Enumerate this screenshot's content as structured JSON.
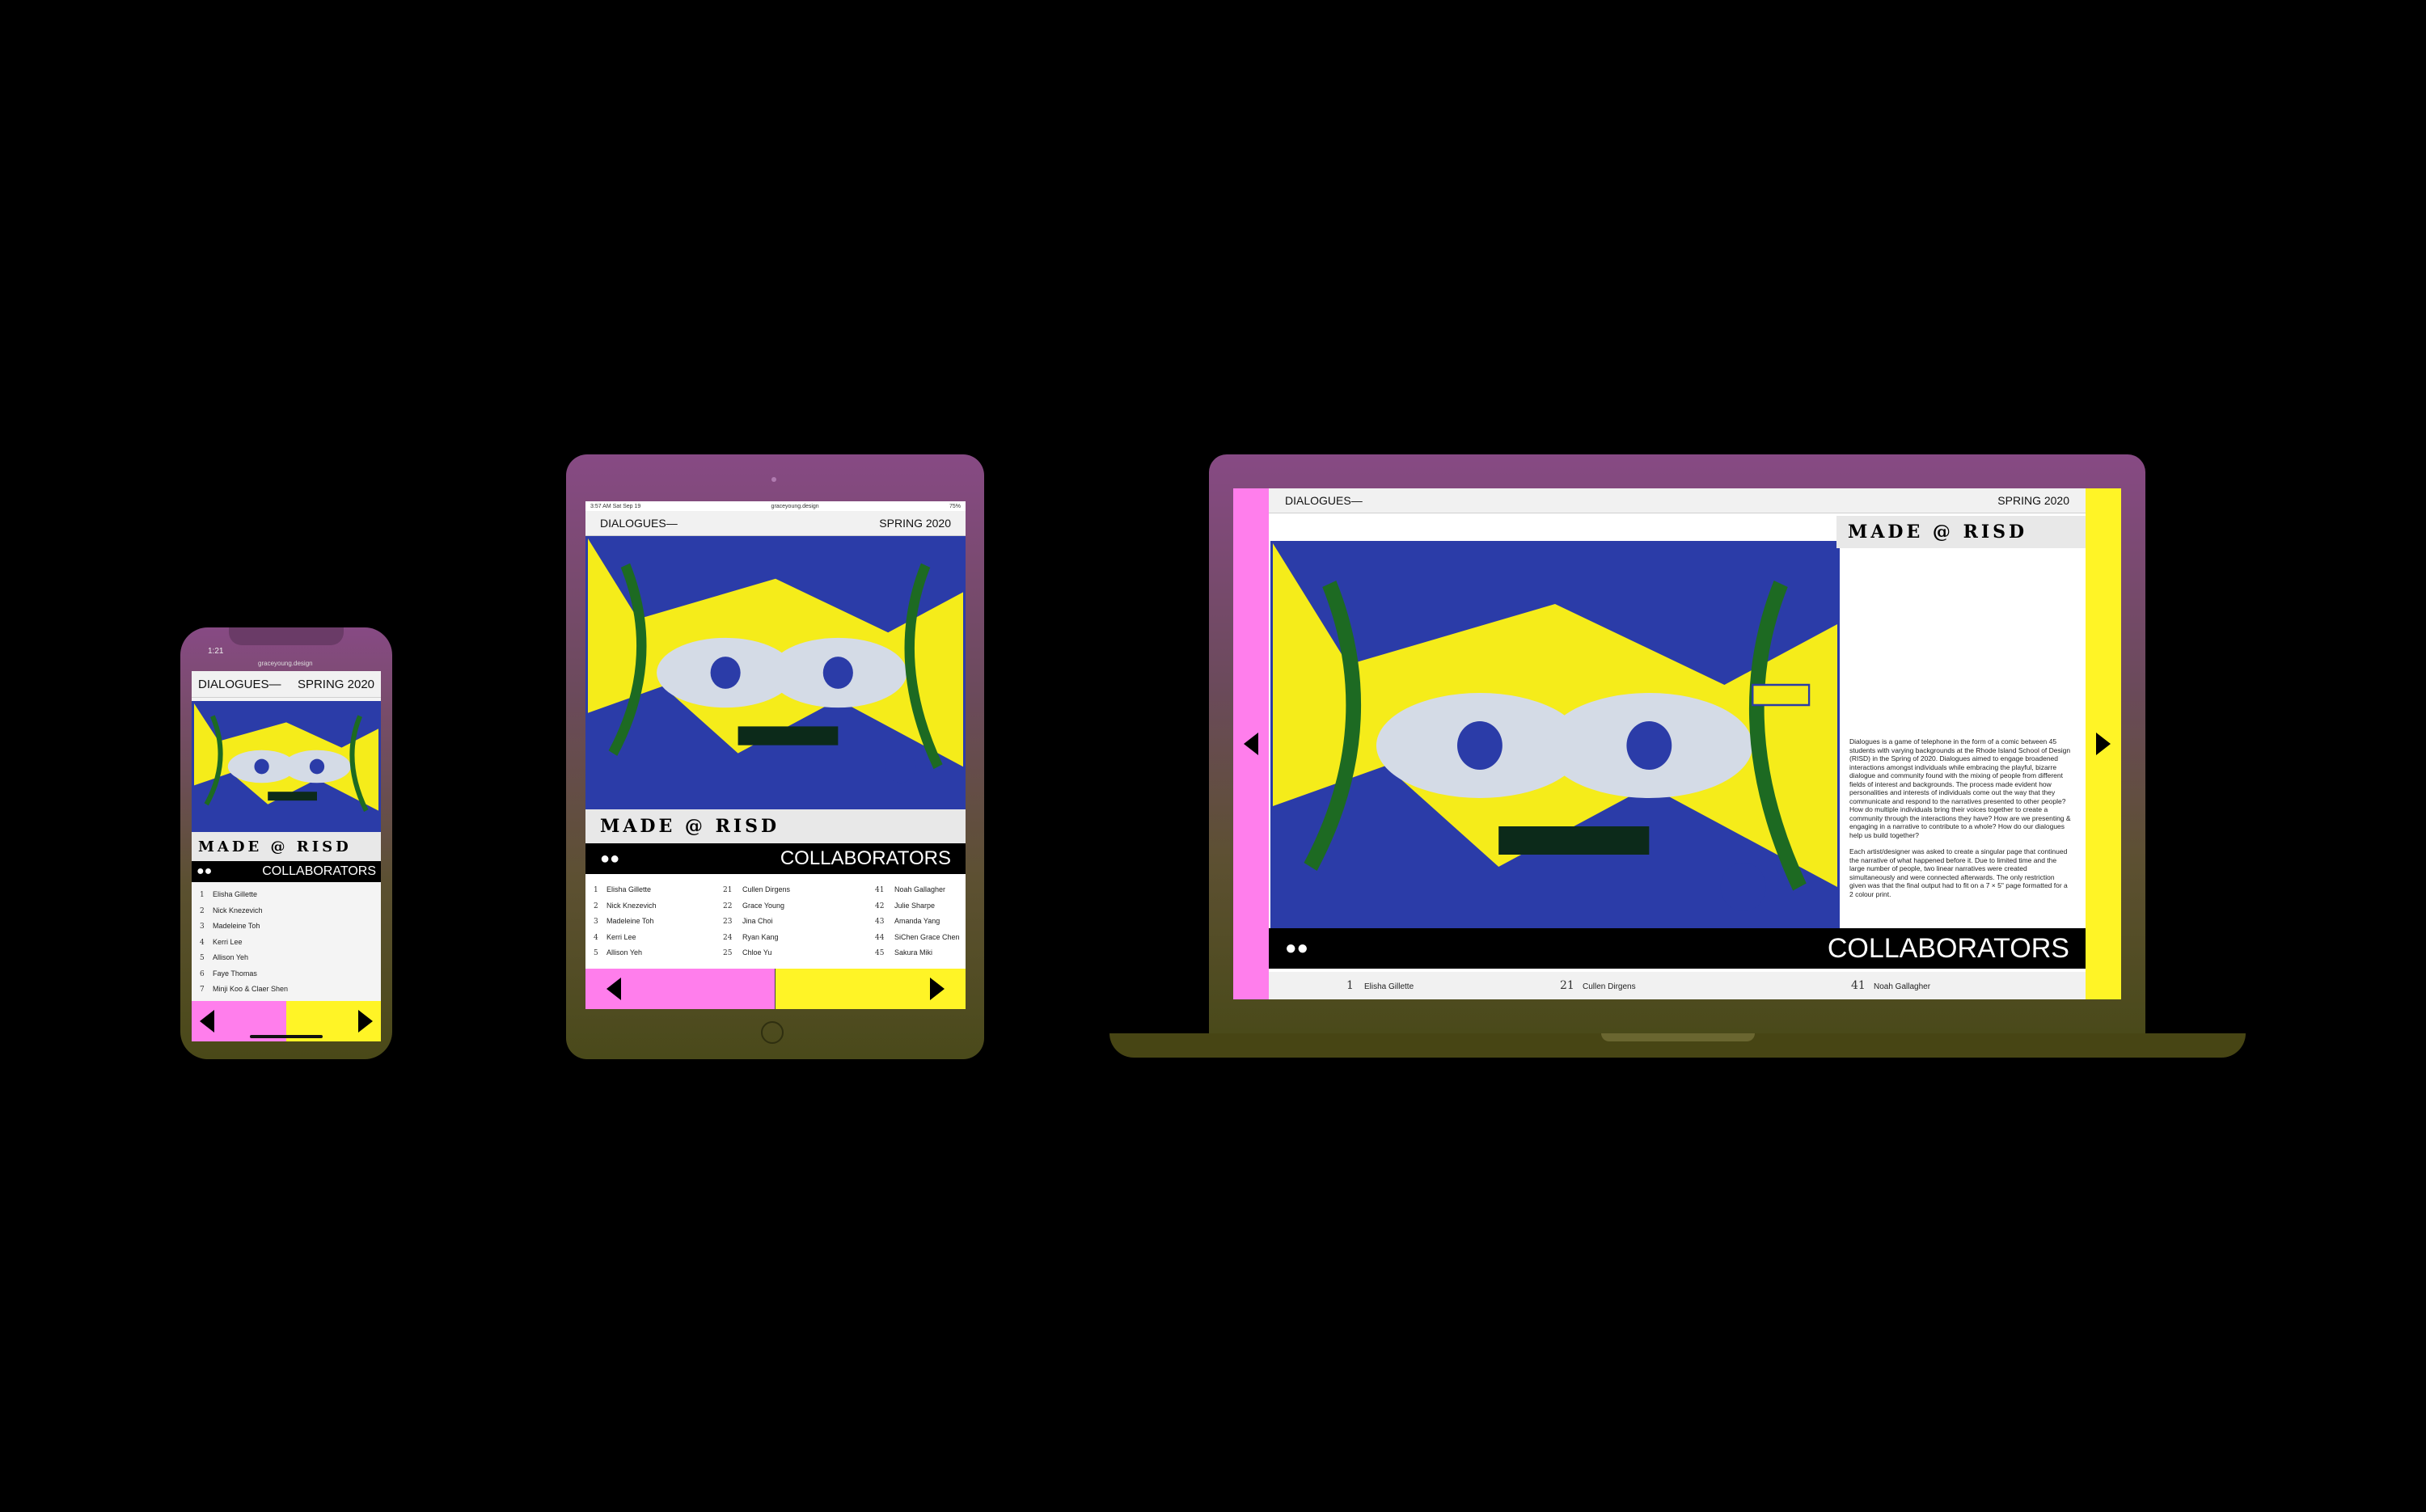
{
  "site": {
    "title": "DIALOGUES—",
    "season": "SPRING 2020",
    "wordmark": "MADE @ RISD",
    "section": "COLLABORATORS",
    "url": "graceyoung.design",
    "glyph_icon": "blob-pair-icon"
  },
  "phone": {
    "time": "1:21",
    "url": "graceyoung.design",
    "collaborators": [
      {
        "num": "1",
        "name": "Elisha Gillette"
      },
      {
        "num": "2",
        "name": "Nick Knezevich"
      },
      {
        "num": "3",
        "name": "Madeleine Toh"
      },
      {
        "num": "4",
        "name": "Kerri Lee"
      },
      {
        "num": "5",
        "name": "Allison Yeh"
      },
      {
        "num": "6",
        "name": "Faye Thomas"
      },
      {
        "num": "7",
        "name": "Minji Koo & Claer Shen"
      }
    ]
  },
  "tablet": {
    "status_time": "3:57 AM   Sat Sep 19",
    "url": "graceyoung.design",
    "battery": "75%",
    "columns": [
      [
        {
          "num": "1",
          "name": "Elisha Gillette"
        },
        {
          "num": "2",
          "name": "Nick Knezevich"
        },
        {
          "num": "3",
          "name": "Madeleine Toh"
        },
        {
          "num": "4",
          "name": "Kerri Lee"
        },
        {
          "num": "5",
          "name": "Allison Yeh"
        }
      ],
      [
        {
          "num": "21",
          "name": "Cullen Dirgens"
        },
        {
          "num": "22",
          "name": "Grace Young"
        },
        {
          "num": "23",
          "name": "Jina Choi"
        },
        {
          "num": "24",
          "name": "Ryan Kang"
        },
        {
          "num": "25",
          "name": "Chloe Yu"
        }
      ],
      [
        {
          "num": "41",
          "name": "Noah Gallagher"
        },
        {
          "num": "42",
          "name": "Julie Sharpe"
        },
        {
          "num": "43",
          "name": "Amanda Yang"
        },
        {
          "num": "44",
          "name": "SiChen Grace Chen"
        },
        {
          "num": "45",
          "name": "Sakura Miki"
        }
      ]
    ]
  },
  "laptop": {
    "description_p1": "Dialogues is a game of telephone in the form of a comic between 45 students with varying backgrounds at the Rhode Island School of Design (RISD) in the Spring of 2020. Dialogues aimed to engage broadened interactions amongst individuals while embracing the playful, bizarre dialogue and community found with the mixing of people from different fields of interest and backgrounds. The process made evident how personalities and interests of individuals come out the way that they communicate and respond to the narratives presented to other people? How do multiple individuals bring their voices together to create a community through the interactions they have? How are we presenting & engaging in a narrative to contribute to a whole? How do our dialogues help us build together?",
    "description_p2": "Each artist/designer was asked to create a singular page that continued the narrative of what happened before it. Due to limited time and the large number of people, two linear narratives were created simultaneously and were connected afterwards. The only restriction given was that the final output had to fit on a 7 × 5\" page formatted for a 2 colour print.",
    "collaborators": [
      {
        "num": "1",
        "name": "Elisha Gillette"
      },
      {
        "num": "21",
        "name": "Cullen Dirgens"
      },
      {
        "num": "41",
        "name": "Noah Gallagher"
      }
    ]
  },
  "colors": {
    "pink": "#ff7eec",
    "yellow": "#fff426",
    "blue": "#2b3ca8",
    "device": "#874a84"
  }
}
